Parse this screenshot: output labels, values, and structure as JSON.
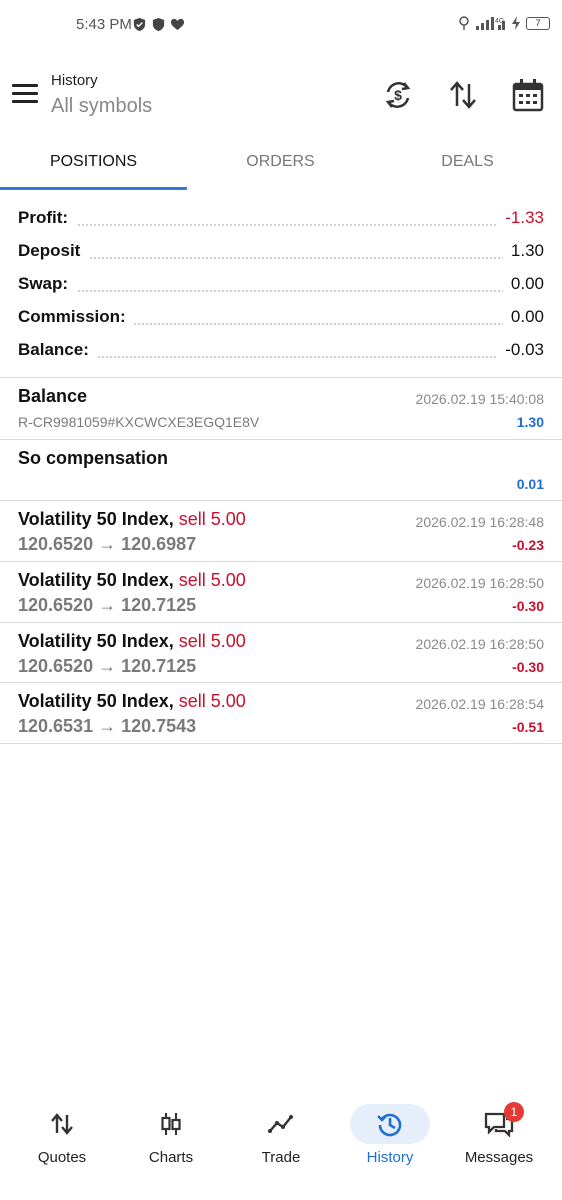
{
  "status_bar": {
    "time": "5:43 PM",
    "network_label": "4G",
    "battery": "7"
  },
  "header": {
    "title": "History",
    "subtitle": "All symbols",
    "icons": [
      "currency-sync-icon",
      "sort-icon",
      "calendar-icon"
    ]
  },
  "tabs": [
    {
      "label": "POSITIONS",
      "active": true
    },
    {
      "label": "ORDERS",
      "active": false
    },
    {
      "label": "DEALS",
      "active": false
    }
  ],
  "summary": {
    "profit_label": "Profit:",
    "profit_value": "-1.33",
    "deposit_label": "Deposit",
    "deposit_value": "1.30",
    "swap_label": "Swap:",
    "swap_value": "0.00",
    "commission_label": "Commission:",
    "commission_value": "0.00",
    "balance_label": "Balance:",
    "balance_value": "-0.03"
  },
  "history": {
    "balance_entry": {
      "title": "Balance",
      "reference": "R-CR9981059#KXCWCXE3EGQ1E8V",
      "time": "2026.02.19 15:40:08",
      "amount": "1.30"
    },
    "compensation_entry": {
      "title": "So compensation",
      "amount": "0.01"
    },
    "positions": [
      {
        "symbol": "Volatility 50 Index,",
        "side": "sell 5.00",
        "prices": "120.6520 → 120.6987",
        "time": "2026.02.19 16:28:48",
        "profit": "-0.23"
      },
      {
        "symbol": "Volatility 50 Index,",
        "side": "sell 5.00",
        "prices": "120.6520 → 120.7125",
        "time": "2026.02.19 16:28:50",
        "profit": "-0.30"
      },
      {
        "symbol": "Volatility 50 Index,",
        "side": "sell 5.00",
        "prices": "120.6520 → 120.7125",
        "time": "2026.02.19 16:28:50",
        "profit": "-0.30"
      },
      {
        "symbol": "Volatility 50 Index,",
        "side": "sell 5.00",
        "prices": "120.6531 → 120.7543",
        "time": "2026.02.19 16:28:54",
        "profit": "-0.51"
      }
    ]
  },
  "bottom_nav": {
    "items": [
      {
        "label": "Quotes",
        "icon": "quotes-icon"
      },
      {
        "label": "Charts",
        "icon": "candlestick-icon"
      },
      {
        "label": "Trade",
        "icon": "trade-line-icon"
      },
      {
        "label": "History",
        "icon": "history-icon",
        "active": true
      },
      {
        "label": "Messages",
        "icon": "messages-icon",
        "badge": "1"
      }
    ]
  },
  "colors": {
    "accent": "#2a7ed8",
    "negative": "#c8102e",
    "positive_blue": "#1e6fd0"
  }
}
